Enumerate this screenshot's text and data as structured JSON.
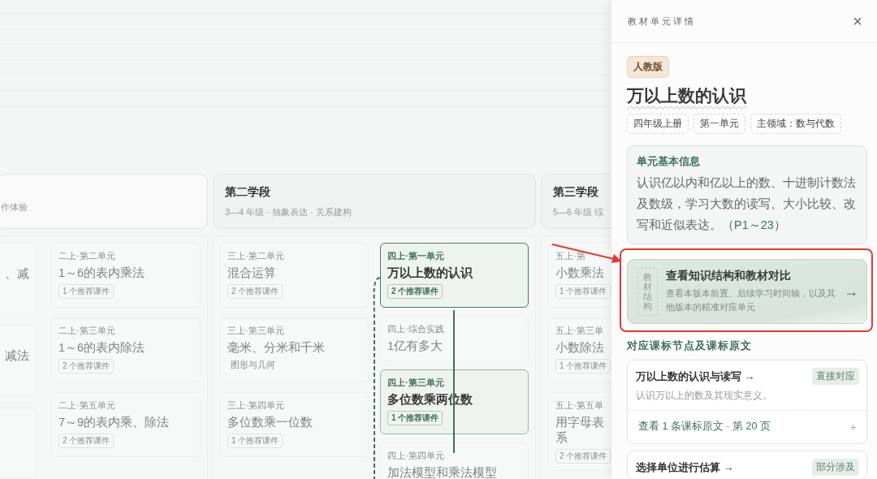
{
  "stages": [
    {
      "subtitle": "作体验",
      "columns": [
        [
          {
            "title": "、减",
            "selected": false,
            "related": false
          },
          {
            "title": "减法",
            "selected": false,
            "related": false
          },
          {
            "selected": false,
            "related": false
          }
        ],
        [
          {
            "label": "二上·第二单元",
            "title": "1～6的表内乘法",
            "badge": "1 个推荐课件",
            "selected": false,
            "related": false
          },
          {
            "label": "二上·第三单元",
            "title": "1～6的表内除法",
            "badge": "2 个推荐课件",
            "selected": false,
            "related": false
          },
          {
            "label": "二上·第五单元",
            "title": "7～9的表内乘、除法",
            "badge": "2 个推荐课件",
            "selected": false,
            "related": false
          }
        ]
      ]
    },
    {
      "title": "第二学段",
      "subtitle": "3—4 年级 · 抽象表达 · 关系建构",
      "columns": [
        [
          {
            "label": "三上·第二单元",
            "title": "混合运算",
            "badge": "2 个推荐课件",
            "selected": false,
            "related": false
          },
          {
            "label": "三上·第三单元",
            "title": "毫米、分米和千米",
            "domain": "图形与几何",
            "selected": false,
            "related": false
          },
          {
            "label": "三上·第四单元",
            "title": "多位数乘一位数",
            "badge": "1 个推荐课件",
            "selected": false,
            "related": false
          }
        ],
        [
          {
            "label": "四上·第一单元",
            "title": "万以上数的认识",
            "badge": "2 个推荐课件",
            "selected": true,
            "related": false
          },
          {
            "label": "四上·综合实践",
            "title": "1亿有多大",
            "selected": false,
            "related": false
          },
          {
            "label": "四上·第三单元",
            "title": "多位数乘两位数",
            "badge": "1 个推荐课件",
            "selected": false,
            "related": true
          },
          {
            "label": "四上·第四单元",
            "title": "加法模型和乘法模型",
            "selected": false,
            "related": false
          }
        ]
      ]
    },
    {
      "title": "第三学段",
      "subtitle": "5—6 年级 综",
      "columns": [
        [
          {
            "label": "五上·第",
            "title": "小数乘法",
            "badge": "1 个推荐课件",
            "selected": false,
            "related": false
          },
          {
            "label": "五上·第三单",
            "title": "小数除法",
            "badge": "1 个推荐课件",
            "selected": false,
            "related": false
          },
          {
            "label": "五上·第五单",
            "title": "用字母表系",
            "badge": "2 个推荐课件",
            "selected": false,
            "related": false
          }
        ]
      ]
    }
  ],
  "panel": {
    "heading": "教材单元详情",
    "close": "×",
    "edition": "人教版",
    "title": "万以上数的认识",
    "tags": [
      "四年级上册",
      "第一单元",
      "主领域：数与代数"
    ],
    "info": {
      "heading": "单元基本信息",
      "text": "认识亿以内和亿以上的数、十进制计数法及数级，学习大数的读写、大小比较、改写和近似表达。",
      "pages": "（P1～23）"
    },
    "structure": {
      "tag": "教材结构",
      "title": "查看知识结构和教材对比",
      "text": "查看本版本前置、后续学习时间轴，以及其他版本的精准对应单元",
      "arrow": "→"
    },
    "standards_heading": "对应课标节点及课标原文",
    "standards": [
      {
        "title": "万以上数的认识与读写 →",
        "relation": "直接对应",
        "text": "认识万以上的数及其现实意义。",
        "link": "查看 1 条课标原文 · 第 20 页",
        "expand": "+"
      },
      {
        "title": "选择单位进行估算 →",
        "relation": "部分涉及"
      }
    ]
  }
}
